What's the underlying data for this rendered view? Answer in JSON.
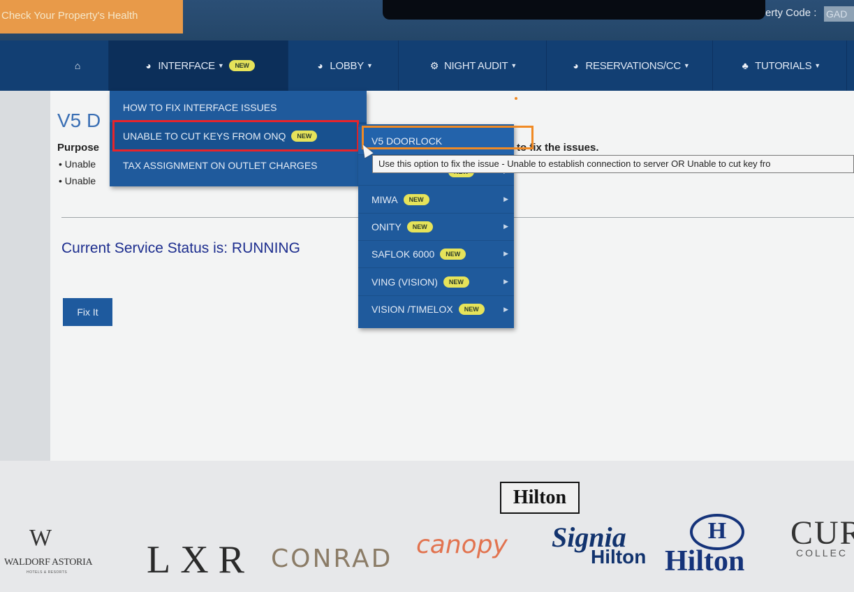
{
  "header": {
    "health_button": "Check Your Property's Health",
    "property_code_label": "erty Code :",
    "property_code_value": "GAD"
  },
  "nav": {
    "home_icon": "home-icon",
    "items": [
      {
        "label": "INTERFACE",
        "icon": "pie-chart-icon",
        "badge": "NEW",
        "active": true
      },
      {
        "label": "LOBBY",
        "icon": "pie-chart-icon"
      },
      {
        "label": "NIGHT AUDIT",
        "icon": "gear-icon"
      },
      {
        "label": "RESERVATIONS/CC",
        "icon": "pie-chart-icon"
      },
      {
        "label": "TUTORIALS",
        "icon": "tutorial-icon"
      }
    ]
  },
  "interface_menu": {
    "items": [
      {
        "label": "HOW TO FIX INTERFACE ISSUES"
      },
      {
        "label": "UNABLE TO CUT KEYS FROM ONQ",
        "badge": "NEW",
        "highlighted": true
      },
      {
        "label": "TAX ASSIGNMENT ON OUTLET CHARGES"
      }
    ]
  },
  "doorlock_menu": {
    "items": [
      {
        "label": "V5 DOORLOCK",
        "active": true
      },
      {
        "label": "",
        "badge": "NEW"
      },
      {
        "label": "MIWA",
        "badge": "NEW"
      },
      {
        "label": "ONITY",
        "badge": "NEW"
      },
      {
        "label": "SAFLOK 6000",
        "badge": "NEW"
      },
      {
        "label": "VING (VISION)",
        "badge": "NEW"
      },
      {
        "label": "VISION /TIMELOX",
        "badge": "NEW"
      }
    ],
    "tooltip": "Use this option to fix the issue - Unable to establish connection to server OR Unable to cut key fro"
  },
  "main": {
    "title": "V5 D",
    "purpose_label": "Purpose",
    "purpose_tail": "to fix the issues.",
    "bullets": [
      "Unable",
      "Unable"
    ],
    "status": "Current Service Status is: RUNNING",
    "fix_button": "Fix It"
  },
  "footer": {
    "top_brand": "Hilton",
    "brands": {
      "waldorf_mark": "W",
      "waldorf": "WALDORF ASTORIA",
      "waldorf_sub": "HOTELS & RESORTS",
      "lxr": "LXR",
      "conrad": "CONRAD",
      "canopy": "canopy",
      "signia_1": "Signia",
      "signia_2": "Hilton",
      "hilton": "Hilton",
      "hilton_mark": "H",
      "curio": "CUR",
      "curio_sub": "COLLEC"
    }
  },
  "colors": {
    "nav_bg": "#123f73",
    "menu_bg": "#1f5a9c",
    "badge": "#e6e35a",
    "red_highlight": "#e8242a",
    "orange_highlight": "#f08a24",
    "health_button": "#e89a49"
  }
}
